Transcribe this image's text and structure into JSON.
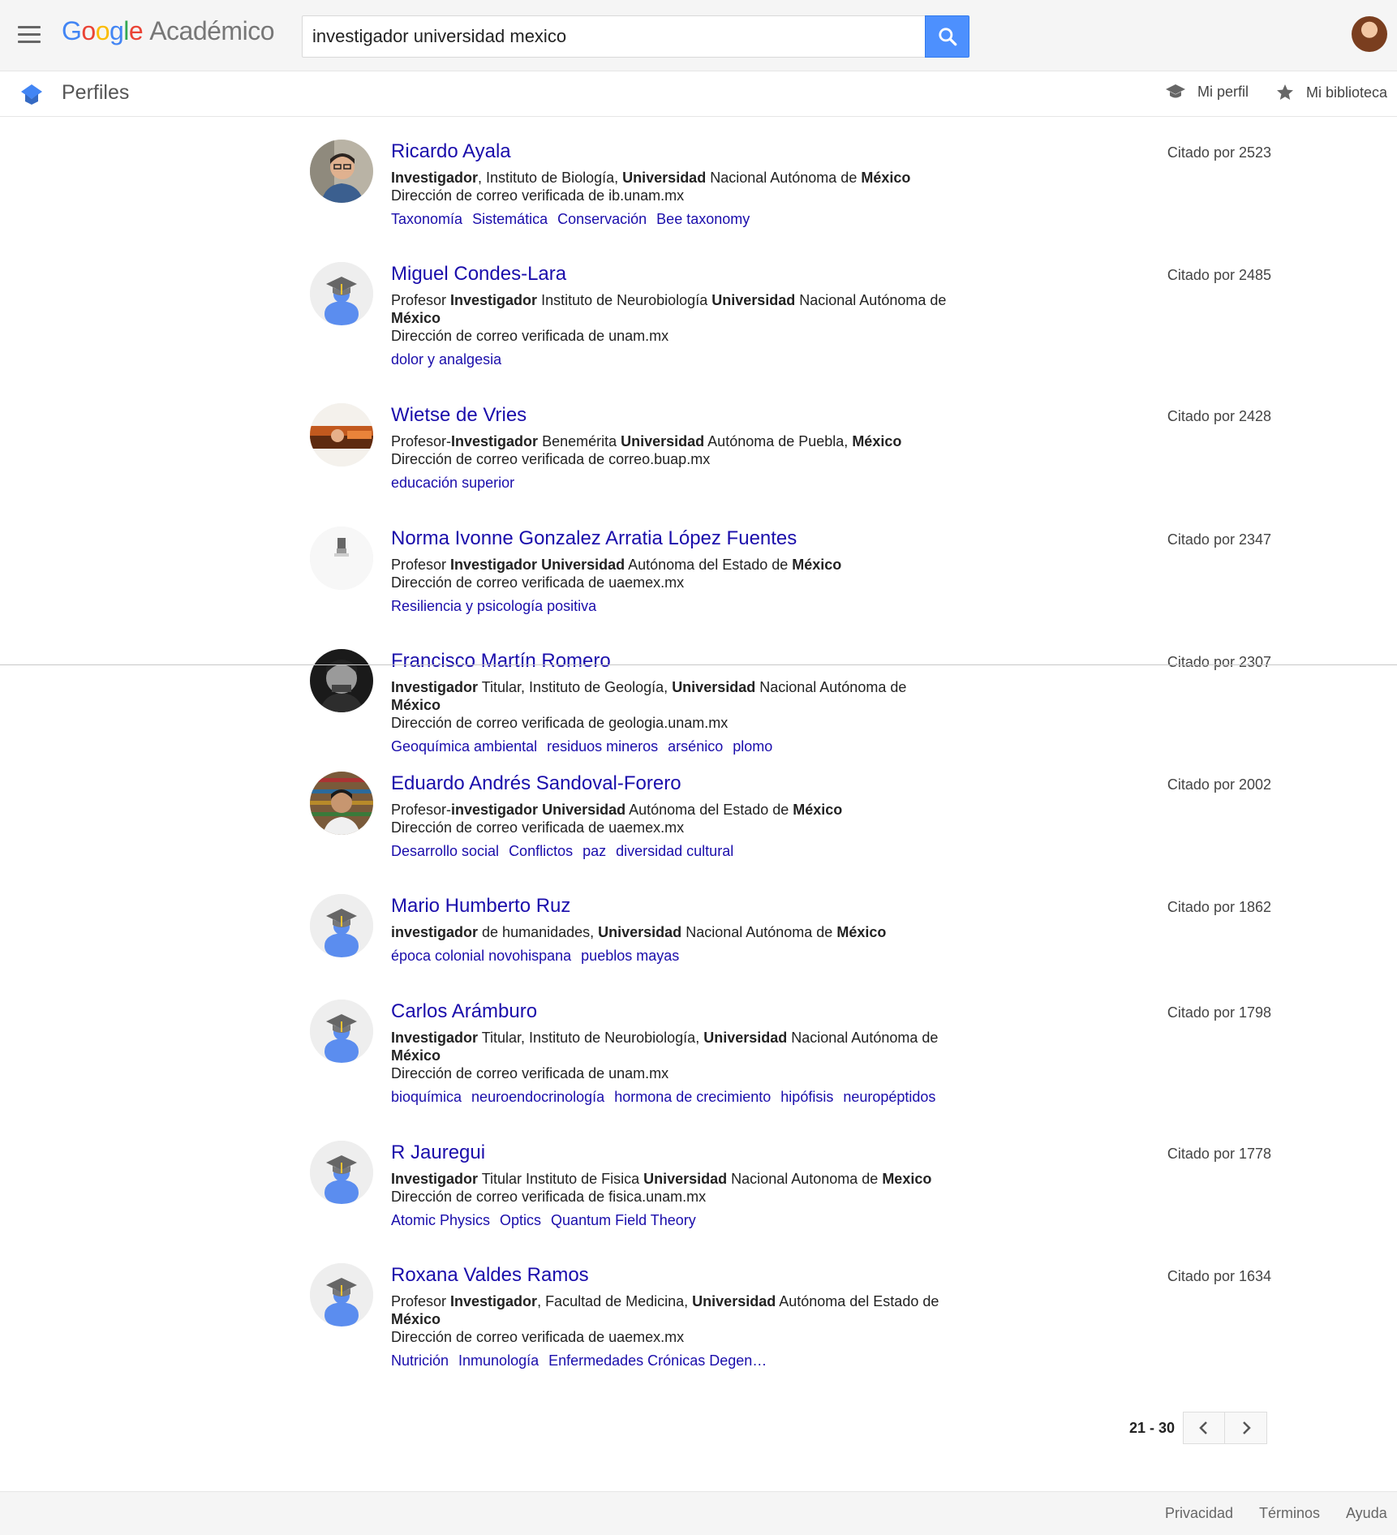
{
  "header": {
    "logo_parts": [
      "G",
      "o",
      "o",
      "g",
      "l",
      "e"
    ],
    "product": "Académico",
    "search_value": "investigador universidad mexico"
  },
  "subbar": {
    "title": "Perfiles",
    "my_profile": "Mi perfil",
    "my_library": "Mi biblioteca"
  },
  "results": [
    {
      "name": "Ricardo Ayala",
      "affiliation": [
        {
          "t": "Investigador",
          "b": true
        },
        {
          "t": ", Instituto de Biología, ",
          "b": false
        },
        {
          "t": "Universidad",
          "b": true
        },
        {
          "t": " Nacional Autónoma de ",
          "b": false
        },
        {
          "t": "México",
          "b": true
        }
      ],
      "email": "Dirección de correo verificada de ib.unam.mx",
      "tags": [
        "Taxonomía",
        "Sistemática",
        "Conservación",
        "Bee taxonomy"
      ],
      "cited": "Citado por 2523",
      "avatar": "photo-man-glasses"
    },
    {
      "name": "Miguel Condes-Lara",
      "affiliation": [
        {
          "t": "Profesor ",
          "b": false
        },
        {
          "t": "Investigador",
          "b": true
        },
        {
          "t": " Instituto de Neurobiología ",
          "b": false
        },
        {
          "t": "Universidad",
          "b": true
        },
        {
          "t": " Nacional Autónoma de ",
          "b": false
        },
        {
          "t": "México",
          "b": true
        }
      ],
      "email": "Dirección de correo verificada de unam.mx",
      "tags": [
        "dolor y analgesia"
      ],
      "cited": "Citado por 2485",
      "avatar": "default"
    },
    {
      "name": "Wietse de Vries",
      "affiliation": [
        {
          "t": "Profesor-",
          "b": false
        },
        {
          "t": "Investigador",
          "b": true
        },
        {
          "t": " Benemérita ",
          "b": false
        },
        {
          "t": "Universidad",
          "b": true
        },
        {
          "t": " Autónoma de Puebla, ",
          "b": false
        },
        {
          "t": "México",
          "b": true
        }
      ],
      "email": "Dirección de correo verificada de correo.buap.mx",
      "tags": [
        "educación superior"
      ],
      "cited": "Citado por 2428",
      "avatar": "photo-orange"
    },
    {
      "name": "Norma Ivonne Gonzalez Arratia López Fuentes",
      "affiliation": [
        {
          "t": "Profesor ",
          "b": false
        },
        {
          "t": "Investigador",
          "b": true
        },
        {
          "t": " ",
          "b": false
        },
        {
          "t": "Universidad",
          "b": true
        },
        {
          "t": " Autónoma del Estado de ",
          "b": false
        },
        {
          "t": "México",
          "b": true
        }
      ],
      "email": "Dirección de correo verificada de uaemex.mx",
      "tags": [
        "Resiliencia y psicología positiva"
      ],
      "cited": "Citado por 2347",
      "avatar": "photo-light"
    },
    {
      "name": "Francisco Martín Romero",
      "affiliation": [
        {
          "t": "Investigador",
          "b": true
        },
        {
          "t": " Titular, Instituto de Geología, ",
          "b": false
        },
        {
          "t": "Universidad",
          "b": true
        },
        {
          "t": " Nacional Autónoma de ",
          "b": false
        },
        {
          "t": "México",
          "b": true
        }
      ],
      "email": "Dirección de correo verificada de geologia.unam.mx",
      "tags": [
        "Geoquímica ambiental",
        "residuos mineros",
        "arsénico",
        "plomo"
      ],
      "cited": "Citado por 2307",
      "avatar": "photo-bw"
    },
    {
      "name": "Eduardo Andrés Sandoval-Forero",
      "affiliation": [
        {
          "t": "Profesor-",
          "b": false
        },
        {
          "t": "investigador",
          "b": true
        },
        {
          "t": " ",
          "b": false
        },
        {
          "t": "Universidad",
          "b": true
        },
        {
          "t": " Autónoma del Estado de ",
          "b": false
        },
        {
          "t": "México",
          "b": true
        }
      ],
      "email": "Dirección de correo verificada de uaemex.mx",
      "tags": [
        "Desarrollo social",
        "Conflictos",
        "paz",
        "diversidad cultural"
      ],
      "cited": "Citado por 2002",
      "avatar": "photo-books"
    },
    {
      "name": "Mario Humberto Ruz",
      "affiliation": [
        {
          "t": "investigador",
          "b": true
        },
        {
          "t": " de humanidades, ",
          "b": false
        },
        {
          "t": "Universidad",
          "b": true
        },
        {
          "t": " Nacional Autónoma de ",
          "b": false
        },
        {
          "t": "México",
          "b": true
        }
      ],
      "email": "",
      "tags": [
        "época colonial novohispana",
        "pueblos mayas"
      ],
      "cited": "Citado por 1862",
      "avatar": "default"
    },
    {
      "name": "Carlos Arámburo",
      "affiliation": [
        {
          "t": "Investigador",
          "b": true
        },
        {
          "t": " Titular, Instituto de Neurobiología, ",
          "b": false
        },
        {
          "t": "Universidad",
          "b": true
        },
        {
          "t": " Nacional Autónoma de ",
          "b": false
        },
        {
          "t": "México",
          "b": true
        }
      ],
      "email": "Dirección de correo verificada de unam.mx",
      "tags": [
        "bioquímica",
        "neuroendocrinología",
        "hormona de crecimiento",
        "hipófisis",
        "neuropéptidos"
      ],
      "cited": "Citado por 1798",
      "avatar": "default"
    },
    {
      "name": "R Jauregui",
      "affiliation": [
        {
          "t": "Investigador",
          "b": true
        },
        {
          "t": " Titular Instituto de Fisica ",
          "b": false
        },
        {
          "t": "Universidad",
          "b": true
        },
        {
          "t": " Nacional Autonoma de ",
          "b": false
        },
        {
          "t": "Mexico",
          "b": true
        }
      ],
      "email": "Dirección de correo verificada de fisica.unam.mx",
      "tags": [
        "Atomic Physics",
        "Optics",
        "Quantum Field Theory"
      ],
      "cited": "Citado por 1778",
      "avatar": "default"
    },
    {
      "name": "Roxana Valdes Ramos",
      "affiliation": [
        {
          "t": "Profesor ",
          "b": false
        },
        {
          "t": "Investigador",
          "b": true
        },
        {
          "t": ", Facultad de Medicina, ",
          "b": false
        },
        {
          "t": "Universidad",
          "b": true
        },
        {
          "t": " Autónoma del Estado de ",
          "b": false
        },
        {
          "t": "México",
          "b": true
        }
      ],
      "email": "Dirección de correo verificada de uaemex.mx",
      "tags": [
        "Nutrición",
        "Inmunología",
        "Enfermedades Crónicas Degen…"
      ],
      "cited": "Citado por 1634",
      "avatar": "default"
    }
  ],
  "pagination": {
    "range": "21 - 30"
  },
  "footer": {
    "privacy": "Privacidad",
    "terms": "Términos",
    "help": "Ayuda"
  },
  "colors": {
    "link": "#1a0dab",
    "search_button": "#4d90fe",
    "default_avatar_body": "#5b8def"
  }
}
